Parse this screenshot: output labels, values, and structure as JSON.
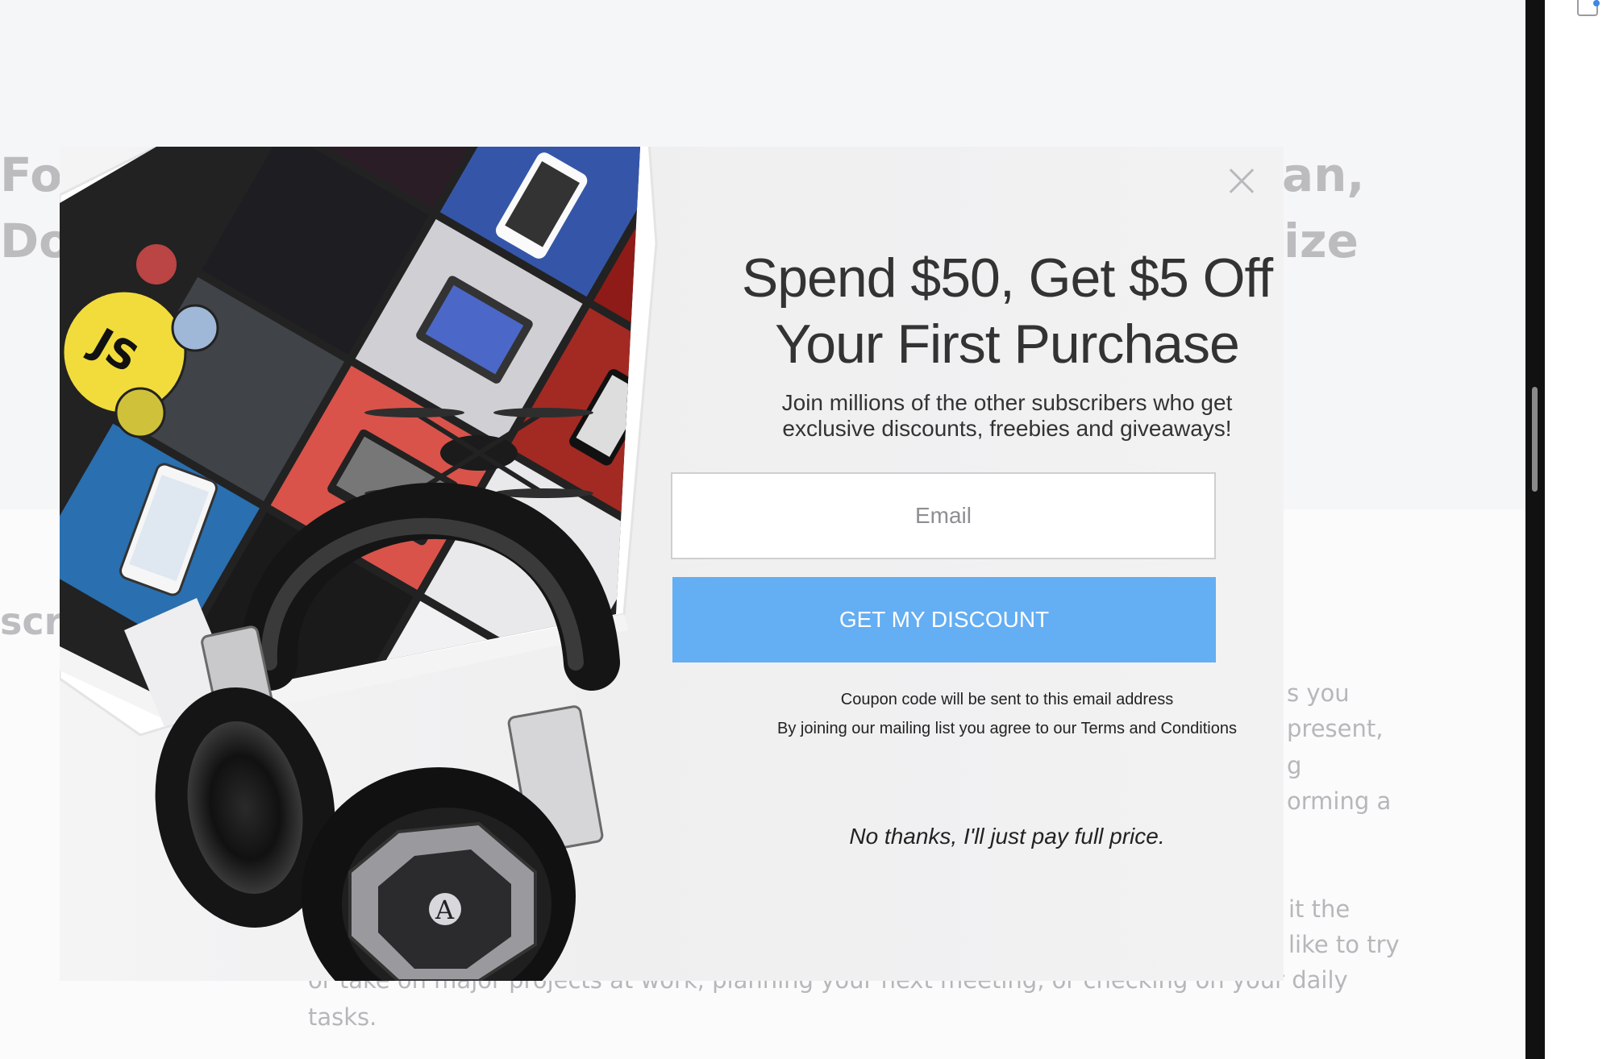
{
  "background": {
    "title_line1_left": "Fo",
    "title_line1_right": "an,",
    "title_line2_left": "Do",
    "title_line2_right": "ize",
    "section_fragment": "scr",
    "right_fragments": [
      "s you",
      "present,",
      "g",
      "orming a",
      "it the",
      "like to try"
    ],
    "bottom_line1": "or take on major projects at work, planning your next meeting, or checking on your daily",
    "bottom_line2": "tasks."
  },
  "modal": {
    "headline_line1": "Spend $50, Get $5 Off",
    "headline_line2": "Your First Purchase",
    "subline_line1": "Join millions of the other subscribers who get",
    "subline_line2": "exclusive discounts, freebies and giveaways!",
    "email_placeholder": "Email",
    "email_value": "",
    "button_label": "GET MY DISCOUNT",
    "note_line1": "Coupon code will be sent to this email address",
    "note_line2": "By joining our mailing list you agree to our Terms and Conditions",
    "decline_label": "No thanks, I'll just pay full price.",
    "close_icon": "close-icon",
    "art_badge": "JS"
  },
  "colors": {
    "button": "#64aef3",
    "js_badge": "#f2dc3c",
    "card_red": "#d9534a"
  }
}
